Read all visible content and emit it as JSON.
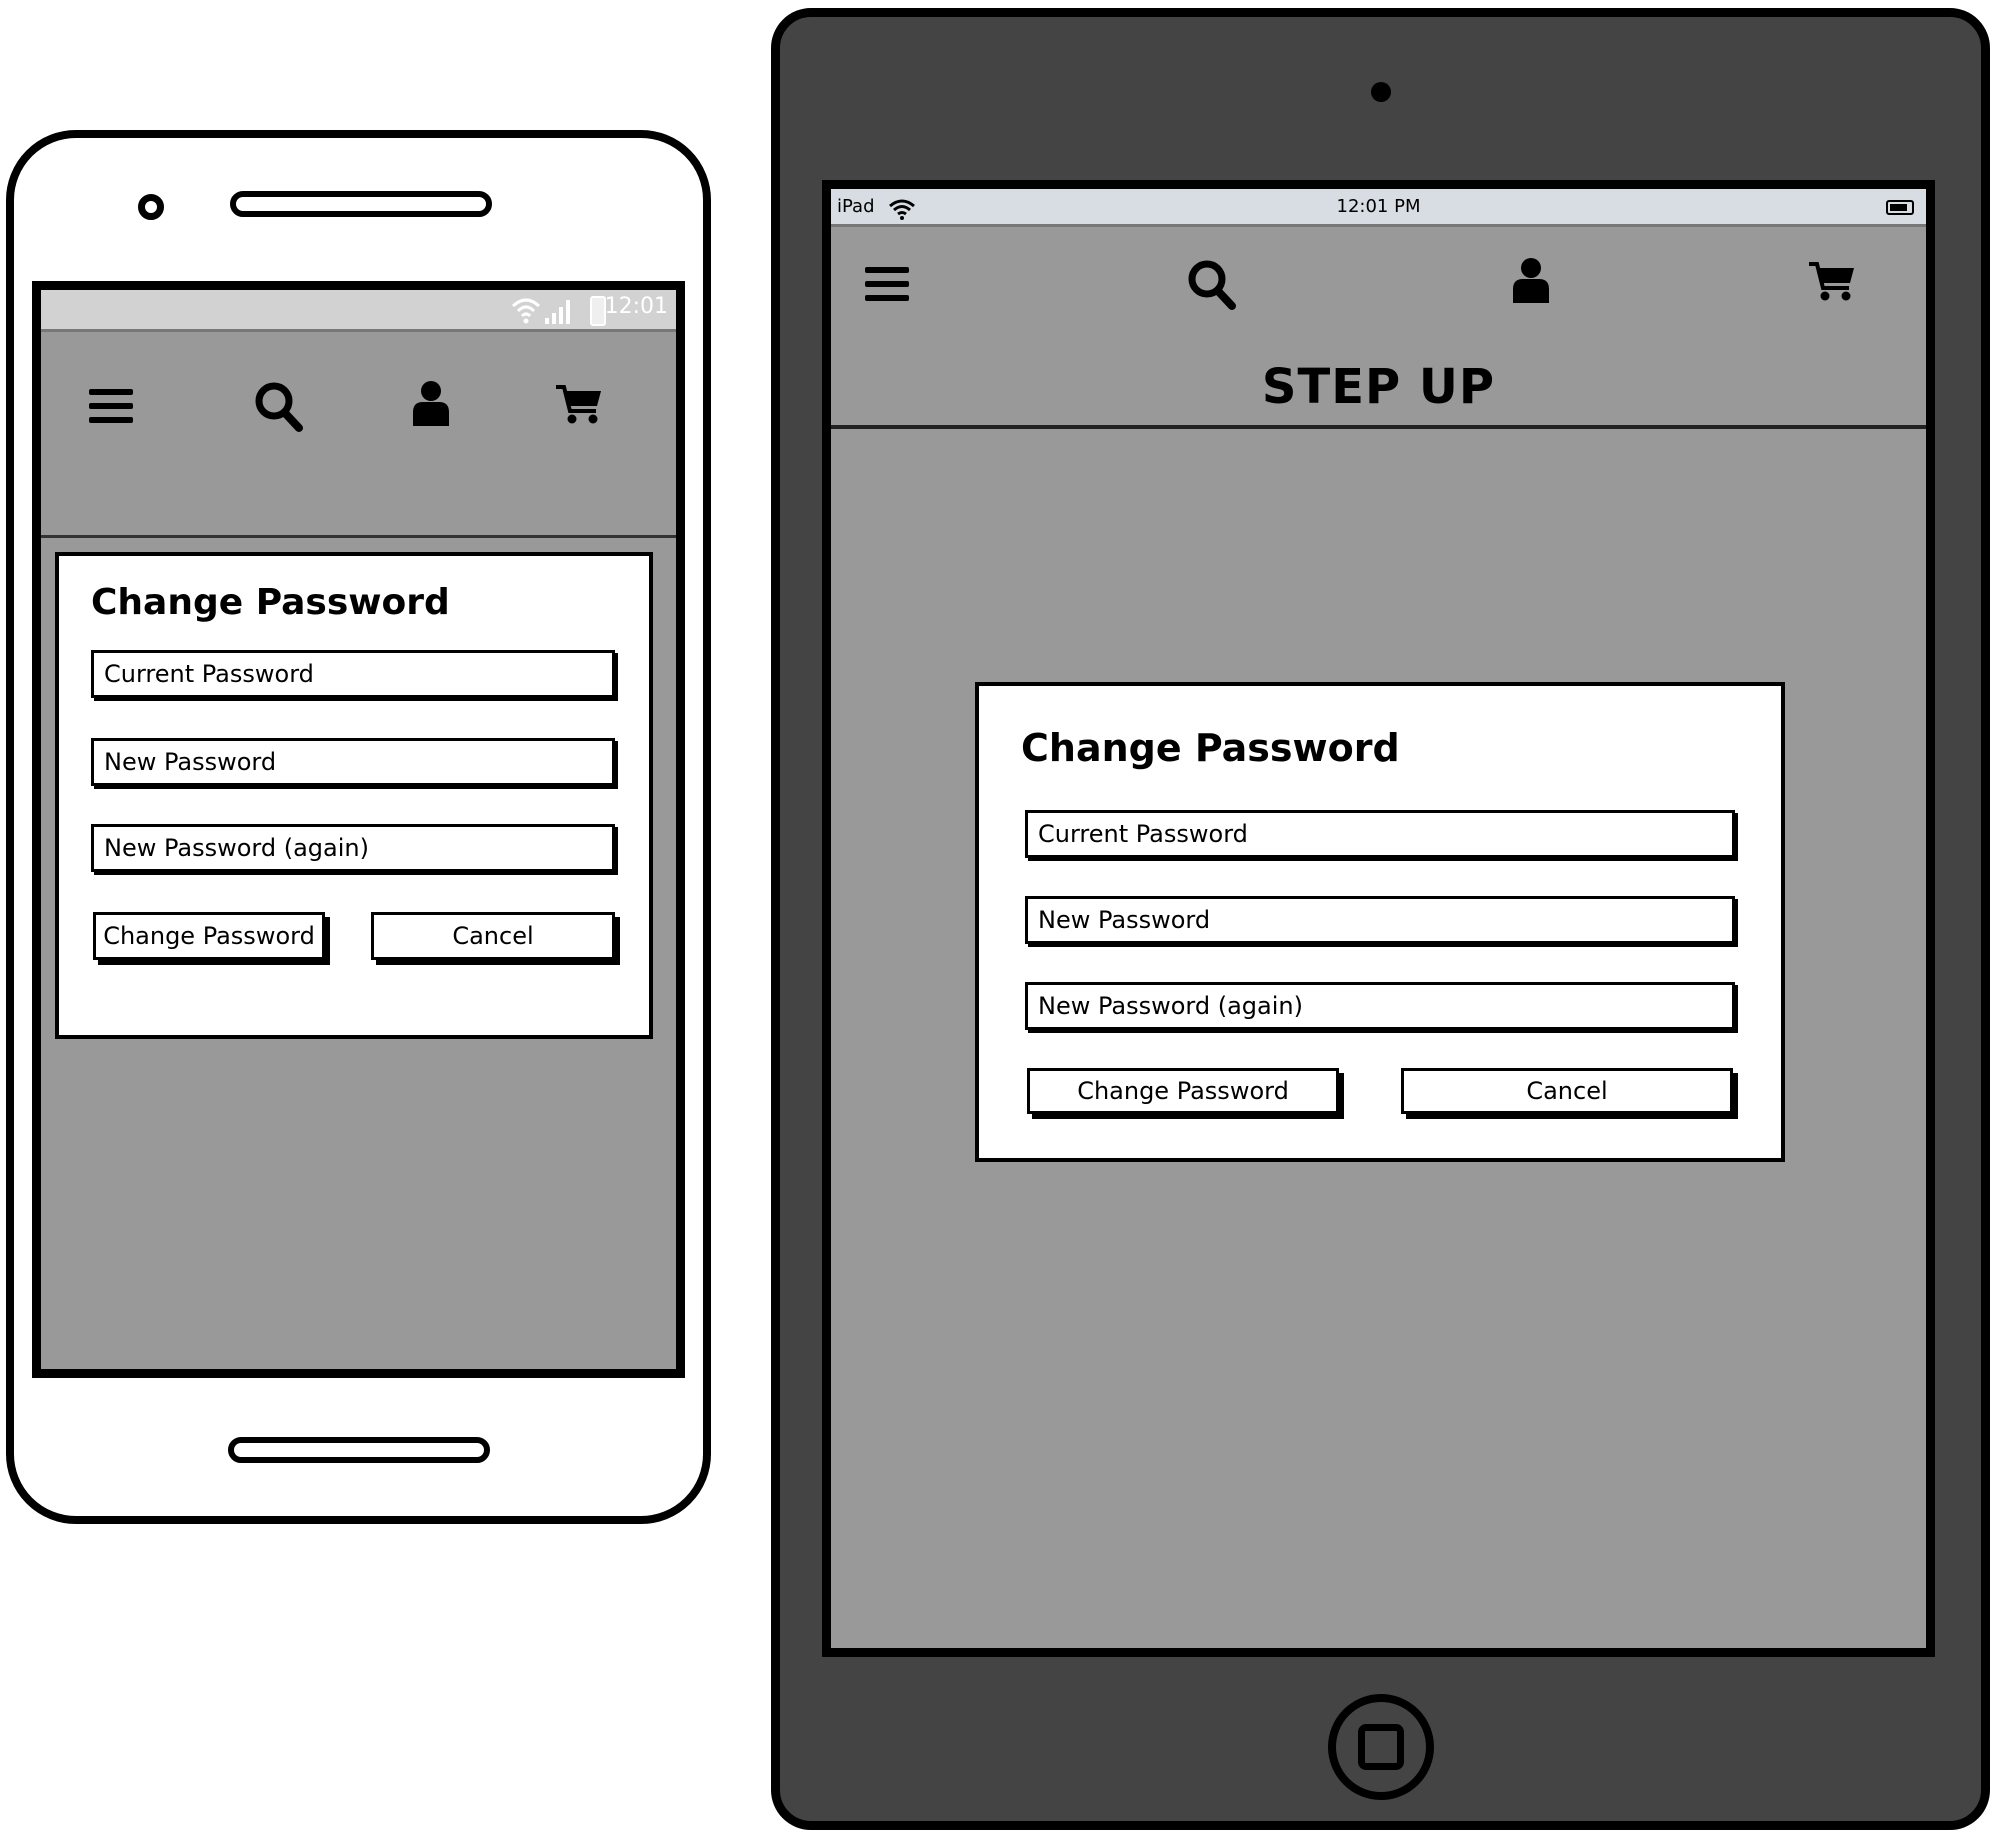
{
  "phone": {
    "status": {
      "time": "12:01"
    },
    "nav": {
      "icons": [
        "menu-icon",
        "search-icon",
        "user-icon",
        "cart-icon"
      ]
    },
    "dialog": {
      "title": "Change Password",
      "fields": {
        "current": "Current Password",
        "new": "New Password",
        "confirm": "New Password (again)"
      },
      "buttons": {
        "submit": "Change Password",
        "cancel": "Cancel"
      }
    }
  },
  "tablet": {
    "status": {
      "carrier": "iPad",
      "time": "12:01 PM"
    },
    "nav": {
      "icons": [
        "menu-icon",
        "search-icon",
        "user-icon",
        "cart-icon"
      ]
    },
    "brand": "STEP UP",
    "dialog": {
      "title": "Change Password",
      "fields": {
        "current": "Current Password",
        "new": "New Password",
        "confirm": "New Password (again)"
      },
      "buttons": {
        "submit": "Change Password",
        "cancel": "Cancel"
      }
    }
  },
  "colors": {
    "screen_bg": "#999999",
    "tablet_frame": "#444444",
    "phone_status_bar": "#d2d2d2",
    "tablet_status_bar": "#d7dde2"
  }
}
